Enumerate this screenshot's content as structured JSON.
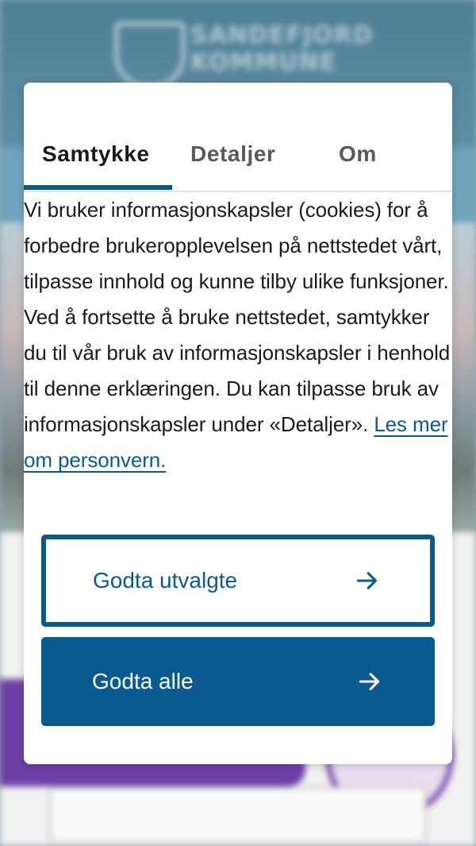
{
  "background": {
    "logo_line1": "SANDEFJORD",
    "logo_line2": "KOMMUNE"
  },
  "tabs": [
    {
      "label": "Samtykke",
      "active": true
    },
    {
      "label": "Detaljer",
      "active": false
    },
    {
      "label": "Om",
      "active": false
    }
  ],
  "consent": {
    "body": "Vi bruker informasjonskapsler (cookies) for å forbedre brukeropplevelsen på nettstedet vårt, tilpasse innhold og kunne tilby ulike funksjoner. Ved å fortsette å bruke nettstedet, samtykker du til vår bruk av informasjonskapsler i henhold til denne erklæringen. Du kan tilpasse bruk av informasjonskapsler under «Detaljer».",
    "link": "Les mer om personvern."
  },
  "buttons": {
    "accept_selected": "Godta utvalgte",
    "accept_all": "Godta alle"
  },
  "icons": {
    "button_arrow": "arrow-right-icon"
  },
  "colors": {
    "accent": "#0b5a8c",
    "primary_button": "#0a5a92",
    "background_purple": "#6c3fa6"
  }
}
